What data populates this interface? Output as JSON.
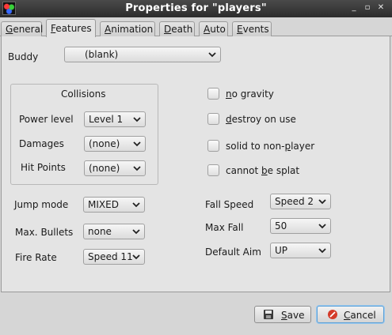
{
  "window": {
    "title": "Properties for \"players\"",
    "controls": {
      "minimize": "_",
      "maximize": "▫",
      "close": "✕"
    }
  },
  "tabs": [
    {
      "label": "General",
      "mnemonic": "G",
      "rest": "eneral",
      "active": false
    },
    {
      "label": "Features",
      "mnemonic": "F",
      "rest": "eatures",
      "active": true
    },
    {
      "label": "Animation",
      "mnemonic": "A",
      "rest": "nimation",
      "active": false
    },
    {
      "label": "Death",
      "mnemonic": "D",
      "rest": "eath",
      "active": false
    },
    {
      "label": "Auto",
      "mnemonic": "A",
      "rest": "uto",
      "active": false
    },
    {
      "label": "Events",
      "mnemonic": "E",
      "rest": "vents",
      "active": false
    }
  ],
  "buddy": {
    "label": "Buddy",
    "value": "(blank)"
  },
  "collisions": {
    "title": "Collisions",
    "power_level": {
      "label": "Power level",
      "value": "Level 1"
    },
    "damages": {
      "label": "Damages",
      "value": "(none)"
    },
    "hit_points": {
      "label": "Hit Points",
      "value": "(none)"
    }
  },
  "checkboxes": {
    "no_gravity": {
      "pre": "",
      "mn": "n",
      "post": "o gravity",
      "checked": false
    },
    "destroy_on_use": {
      "pre": "",
      "mn": "d",
      "post": "estroy on use",
      "checked": false
    },
    "solid_to_non_player": {
      "pre": "solid to non-",
      "mn": "p",
      "post": "layer",
      "checked": false
    },
    "cannot_be_splat": {
      "pre": "cannot ",
      "mn": "b",
      "post": "e splat",
      "checked": false
    }
  },
  "left_fields": {
    "jump_mode": {
      "label": "Jump mode",
      "value": "MIXED"
    },
    "max_bullets": {
      "label": "Max. Bullets",
      "value": "none"
    },
    "fire_rate": {
      "label": "Fire Rate",
      "value": "Speed 11"
    }
  },
  "right_fields": {
    "fall_speed": {
      "label": "Fall Speed",
      "value": "Speed 2"
    },
    "max_fall": {
      "label": "Max Fall",
      "value": "50"
    },
    "default_aim": {
      "label": "Default Aim",
      "value": "UP"
    }
  },
  "buttons": {
    "save": {
      "mn": "S",
      "rest": "ave"
    },
    "cancel": {
      "mn": "C",
      "rest": "ancel"
    }
  },
  "colors": {
    "accent": "#5aa0d8",
    "cancel_icon": "#d43b2a",
    "titlebar": "#333333"
  }
}
